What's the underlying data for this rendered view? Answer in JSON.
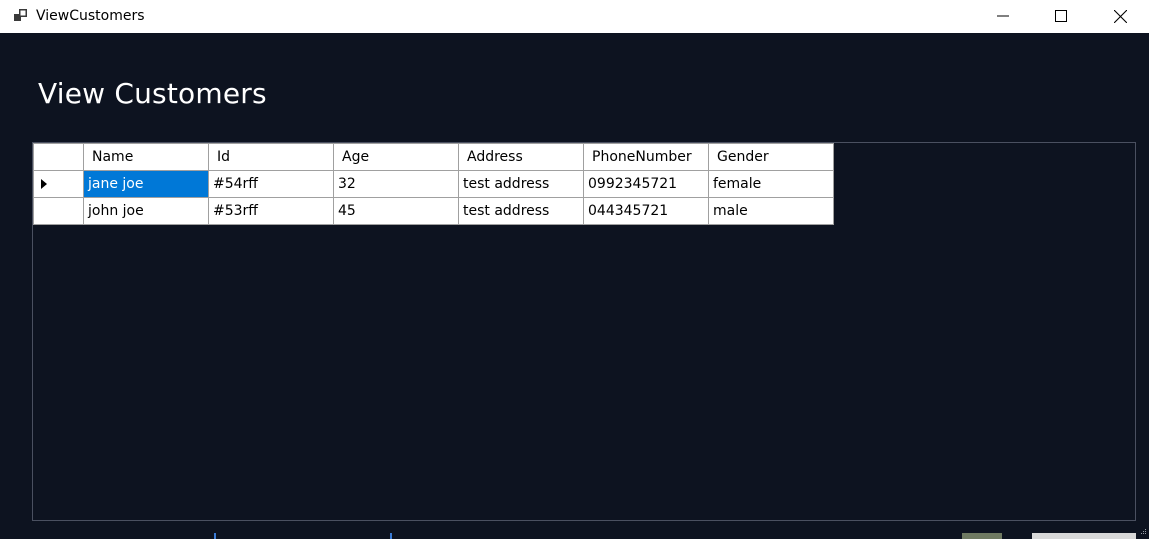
{
  "window": {
    "title": "ViewCustomers",
    "icon": "app-window-icon"
  },
  "page": {
    "title": "View Customers"
  },
  "grid": {
    "columns": [
      "Name",
      "Id",
      "Age",
      "Address",
      "PhoneNumber",
      "Gender"
    ],
    "rows": [
      {
        "name": "jane joe",
        "id": "#54rff",
        "age": "32",
        "address": "test address",
        "phone": "0992345721",
        "gender": "female"
      },
      {
        "name": "john joe",
        "id": "#53rff",
        "age": "45",
        "address": "test address",
        "phone": "044345721",
        "gender": "male"
      }
    ],
    "selected_cell": {
      "row": 0,
      "column": "name"
    },
    "selection_color": "#0078d7"
  },
  "colors": {
    "background": "#0d1320",
    "titlebar": "#ffffff"
  }
}
